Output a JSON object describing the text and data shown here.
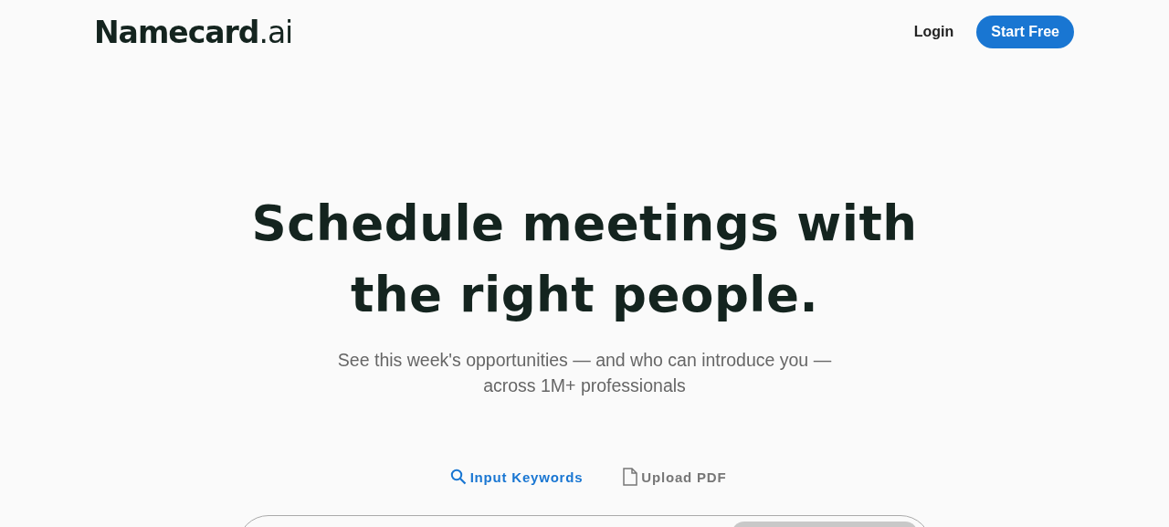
{
  "header": {
    "logo": {
      "brand": "Namecard",
      "suffix": ".ai"
    },
    "login": "Login",
    "cta": "Start Free"
  },
  "hero": {
    "title_lines": [
      "Schedule meetings with",
      "the right people."
    ],
    "subtitle_lines": [
      "See this week's opportunities — and who can introduce you —",
      "across 1M+ professionals"
    ]
  },
  "tabs": [
    {
      "kind": "search",
      "label": "Input Keywords",
      "selected": true
    },
    {
      "kind": "file",
      "label": "Upload PDF",
      "selected": false
    }
  ]
}
